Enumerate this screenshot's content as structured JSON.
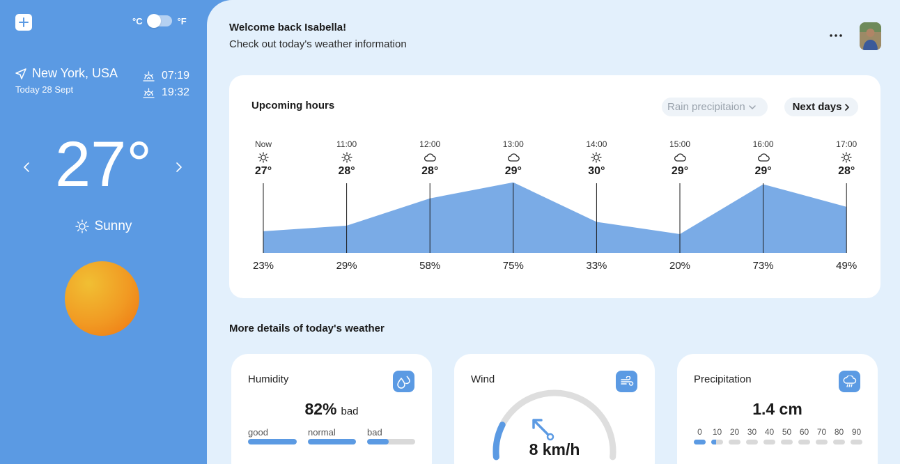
{
  "sidebar": {
    "units": {
      "celsius": "°C",
      "fahrenheit": "°F"
    },
    "location": "New York, USA",
    "date": "Today 28 Sept",
    "sunrise": "07:19",
    "sunset": "19:32",
    "temperature": "27°",
    "condition": "Sunny",
    "icons": {
      "add": "plus-icon",
      "location": "navigation-arrow-icon",
      "sunrise": "sunrise-icon",
      "sunset": "sunset-icon",
      "prev": "chevron-left-icon",
      "next": "chevron-right-icon",
      "condition": "sun-icon"
    }
  },
  "header": {
    "title": "Welcome back Isabella!",
    "subtitle": "Check out today's weather information",
    "more_icon": "more-horizontal-icon"
  },
  "upcoming": {
    "title": "Upcoming hours",
    "dropdown_value": "Rain precipitaion",
    "next_days_label": "Next days",
    "hours": [
      {
        "time": "Now",
        "icon": "sun",
        "temp": "27°",
        "precip": "23%"
      },
      {
        "time": "11:00",
        "icon": "sun",
        "temp": "28°",
        "precip": "29%"
      },
      {
        "time": "12:00",
        "icon": "cloud",
        "temp": "28°",
        "precip": "58%"
      },
      {
        "time": "13:00",
        "icon": "cloud",
        "temp": "29°",
        "precip": "75%"
      },
      {
        "time": "14:00",
        "icon": "sun",
        "temp": "30°",
        "precip": "33%"
      },
      {
        "time": "15:00",
        "icon": "cloud",
        "temp": "29°",
        "precip": "20%"
      },
      {
        "time": "16:00",
        "icon": "cloud",
        "temp": "29°",
        "precip": "73%"
      },
      {
        "time": "17:00",
        "icon": "sun",
        "temp": "28°",
        "precip": "49%"
      }
    ]
  },
  "chart_data": {
    "type": "area",
    "categories": [
      "Now",
      "11:00",
      "12:00",
      "13:00",
      "14:00",
      "15:00",
      "16:00",
      "17:00"
    ],
    "values": [
      23,
      29,
      58,
      75,
      33,
      20,
      73,
      49
    ],
    "ylim": [
      0,
      100
    ],
    "color": "#7aabe6"
  },
  "details": {
    "title": "More details of today's weather",
    "humidity": {
      "title": "Humidity",
      "value": "82%",
      "tag": "bad",
      "scale": [
        {
          "label": "good",
          "fill": 1.0
        },
        {
          "label": "normal",
          "fill": 1.0
        },
        {
          "label": "bad",
          "fill": 0.45
        }
      ],
      "icon": "humidity-drops-icon"
    },
    "wind": {
      "title": "Wind",
      "value": "8 km/h",
      "gauge_fraction": 0.17,
      "icon": "wind-icon"
    },
    "precipitation": {
      "title": "Precipitation",
      "value": "1.4 cm",
      "scale": [
        "0",
        "10",
        "20",
        "30",
        "40",
        "50",
        "60",
        "70",
        "80",
        "90"
      ],
      "fills": [
        1.0,
        0.4,
        0,
        0,
        0,
        0,
        0,
        0,
        0,
        0
      ],
      "icon": "cloud-rain-icon"
    }
  },
  "colors": {
    "accent": "#5b9ae3",
    "background": "#e3f0fc",
    "sun_start": "#f1bf33",
    "sun_end": "#ee7310"
  }
}
